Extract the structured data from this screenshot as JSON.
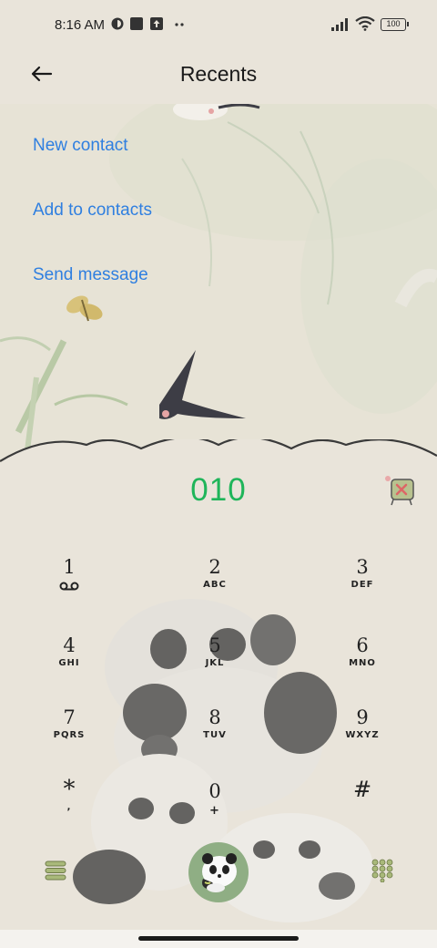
{
  "status_bar": {
    "time": "8:16 AM",
    "battery": "100"
  },
  "header": {
    "title": "Recents"
  },
  "menu": {
    "new_contact": "New contact",
    "add_to_contacts": "Add to contacts",
    "send_message": "Send message"
  },
  "dialer": {
    "number": "010",
    "keys": [
      {
        "digit": "1",
        "letters": ""
      },
      {
        "digit": "2",
        "letters": "ABC"
      },
      {
        "digit": "3",
        "letters": "DEF"
      },
      {
        "digit": "4",
        "letters": "GHI"
      },
      {
        "digit": "5",
        "letters": "JKL"
      },
      {
        "digit": "6",
        "letters": "MNO"
      },
      {
        "digit": "7",
        "letters": "PQRS"
      },
      {
        "digit": "8",
        "letters": "TUV"
      },
      {
        "digit": "9",
        "letters": "WXYZ"
      },
      {
        "digit": "*",
        "letters": ","
      },
      {
        "digit": "0",
        "letters": "+"
      },
      {
        "digit": "#",
        "letters": ""
      }
    ]
  },
  "colors": {
    "accent_blue": "#2f7fe0",
    "number_green": "#1fb55a",
    "background": "#e9e4da",
    "button_green": "#8fae84"
  },
  "icons": {
    "back": "arrow-left-icon",
    "voicemail": "voicemail-icon",
    "menu": "hamburger-menu-icon",
    "keypad": "keypad-grid-icon",
    "call": "panda-call-icon",
    "delete": "delete-sticker-icon"
  }
}
